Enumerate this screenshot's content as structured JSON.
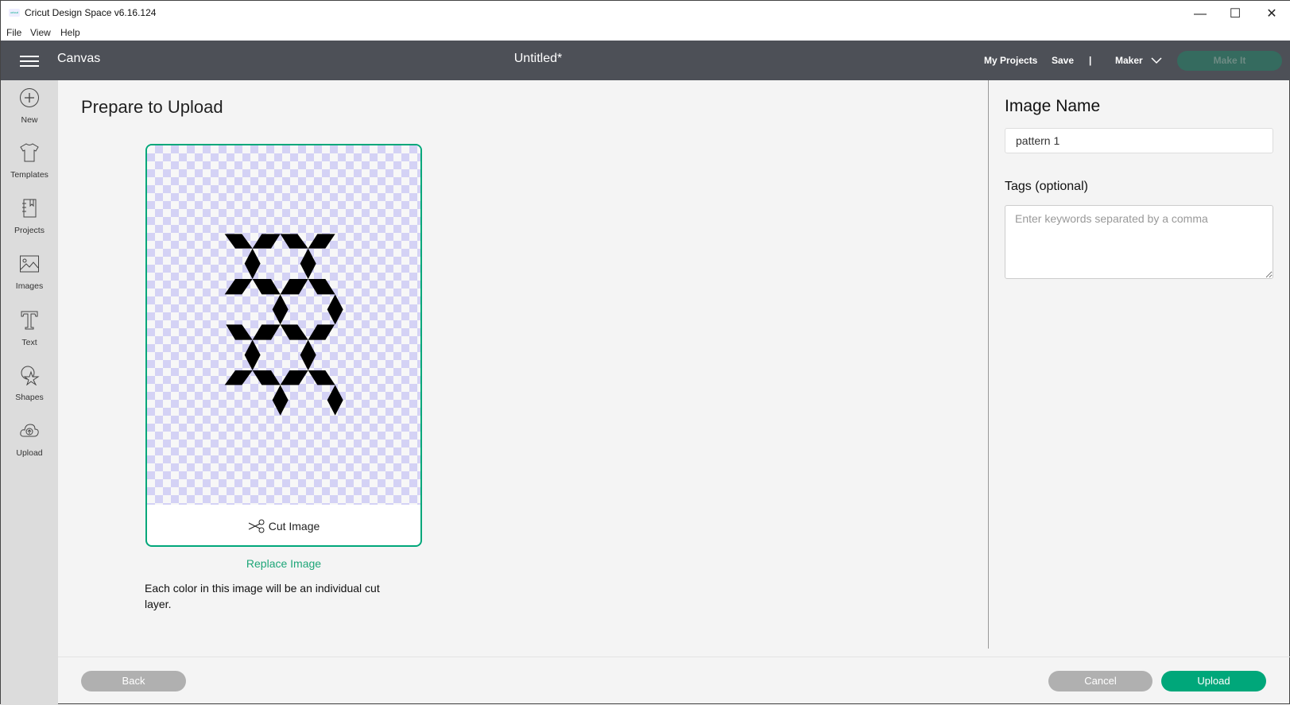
{
  "window": {
    "title": "Cricut Design Space  v6.16.124",
    "logo_text": "cricut",
    "menu": [
      "File",
      "View",
      "Help"
    ]
  },
  "header": {
    "section": "Canvas",
    "doc_title": "Untitled*",
    "my_projects": "My Projects",
    "save": "Save",
    "separator": "|",
    "machine": "Maker",
    "make_it": "Make It"
  },
  "sidebar": {
    "items": [
      {
        "label": "New",
        "icon": "plus-circle-icon"
      },
      {
        "label": "Templates",
        "icon": "shirt-icon"
      },
      {
        "label": "Projects",
        "icon": "notebook-icon"
      },
      {
        "label": "Images",
        "icon": "image-icon"
      },
      {
        "label": "Text",
        "icon": "text-t-icon"
      },
      {
        "label": "Shapes",
        "icon": "shapes-icon"
      },
      {
        "label": "Upload",
        "icon": "cloud-upload-icon"
      }
    ]
  },
  "main": {
    "title": "Prepare to Upload",
    "cut_label": "Cut Image",
    "replace": "Replace Image",
    "note": "Each color in this image will be an individual cut layer."
  },
  "panel": {
    "image_name_label": "Image Name",
    "image_name_value": "pattern 1",
    "tags_label": "Tags (optional)",
    "tags_placeholder": "Enter keywords separated by a comma"
  },
  "footer": {
    "back": "Back",
    "cancel": "Cancel",
    "upload": "Upload"
  },
  "colors": {
    "accent": "#00a77a",
    "header": "#4d5057",
    "sidebar": "#dcdcdc",
    "disabled": "#b0b0b0"
  }
}
